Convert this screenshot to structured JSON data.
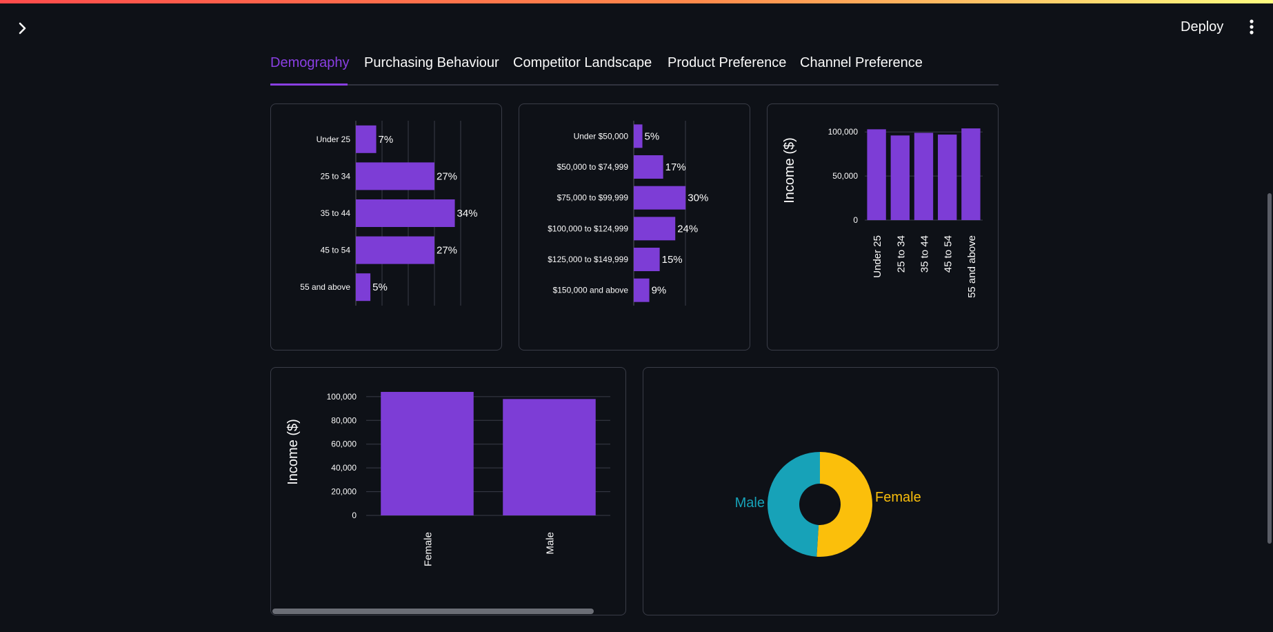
{
  "header": {
    "deploy_label": "Deploy"
  },
  "tabs": [
    {
      "label": "Demography",
      "active": true
    },
    {
      "label": "Purchasing Behaviour"
    },
    {
      "label": "Competitor Landscape"
    },
    {
      "label": "Product Preference"
    },
    {
      "label": "Channel Preference"
    }
  ],
  "colors": {
    "accent": "#8a3fe3",
    "bar": "#7d3dd6",
    "male": "#17a2b8",
    "female": "#fbbf0b",
    "background": "#0e1117"
  },
  "chart_data": [
    {
      "type": "bar",
      "orientation": "horizontal",
      "categories": [
        "Under 25",
        "25 to 34",
        "35 to 44",
        "45 to 54",
        "55 and above"
      ],
      "values": [
        7,
        27,
        34,
        27,
        5
      ],
      "labels": [
        "7%",
        "27%",
        "34%",
        "27%",
        "5%"
      ],
      "grid": true
    },
    {
      "type": "bar",
      "orientation": "horizontal",
      "categories": [
        "Under $50,000",
        "$50,000 to $74,999",
        "$75,000 to $99,999",
        "$100,000 to $124,999",
        "$125,000 to $149,999",
        "$150,000 and above"
      ],
      "values": [
        5,
        17,
        30,
        24,
        15,
        9
      ],
      "labels": [
        "5%",
        "17%",
        "30%",
        "24%",
        "15%",
        "9%"
      ],
      "grid": true
    },
    {
      "type": "bar",
      "categories": [
        "Under 25",
        "25 to 34",
        "35 to 44",
        "45 to 54",
        "55 and above"
      ],
      "values": [
        103000,
        96000,
        99000,
        97000,
        104000
      ],
      "ylabel": "Income ($)",
      "yticks": [
        0,
        50000,
        100000
      ],
      "ytick_labels": [
        "0",
        "50,000",
        "100,000"
      ],
      "ylim": [
        0,
        108000
      ]
    },
    {
      "type": "bar",
      "categories": [
        "Female",
        "Male"
      ],
      "values": [
        104000,
        98000
      ],
      "ylabel": "Income ($)",
      "yticks": [
        0,
        20000,
        40000,
        60000,
        80000,
        100000
      ],
      "ytick_labels": [
        "0",
        "20,000",
        "40,000",
        "60,000",
        "80,000",
        "100,000"
      ],
      "ylim": [
        0,
        104000
      ]
    },
    {
      "type": "pie",
      "hole": true,
      "labels": [
        "Female",
        "Male"
      ],
      "values": [
        51,
        49
      ],
      "colors": [
        "#fbbf0b",
        "#17a2b8"
      ]
    }
  ]
}
